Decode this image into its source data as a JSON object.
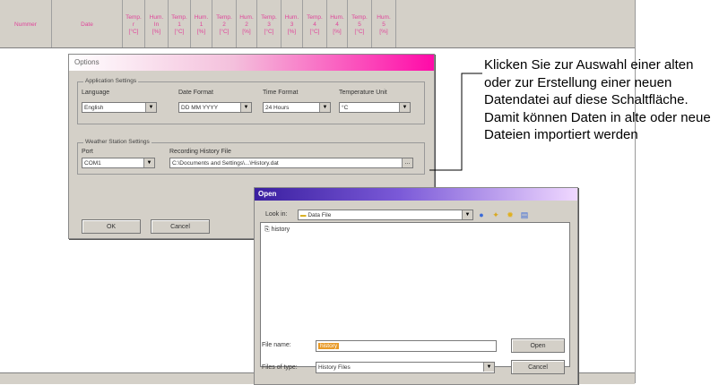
{
  "columns": [
    {
      "lines": [
        "Nummer"
      ]
    },
    {
      "lines": [
        "Date"
      ]
    },
    {
      "lines": [
        "Temp.",
        "r",
        "[°C]"
      ]
    },
    {
      "lines": [
        "Hum.",
        "In",
        "[%]"
      ]
    },
    {
      "lines": [
        "Temp.",
        "1",
        "[°C]"
      ]
    },
    {
      "lines": [
        "Hum.",
        "1",
        "[%]"
      ]
    },
    {
      "lines": [
        "Temp.",
        "2",
        "[°C]"
      ]
    },
    {
      "lines": [
        "Hum.",
        "2",
        "[%]"
      ]
    },
    {
      "lines": [
        "Temp.",
        "3",
        "[°C]"
      ]
    },
    {
      "lines": [
        "Hum.",
        "3",
        "[%]"
      ]
    },
    {
      "lines": [
        "Temp.",
        "4",
        "[°C]"
      ]
    },
    {
      "lines": [
        "Hum.",
        "4",
        "[%]"
      ]
    },
    {
      "lines": [
        "Temp.",
        "5",
        "[°C]"
      ]
    },
    {
      "lines": [
        "Hum.",
        "5",
        "[%]"
      ]
    }
  ],
  "options": {
    "title": "Options",
    "app_group": "Application Settings",
    "language_label": "Language",
    "language_value": "English",
    "date_label": "Date Format",
    "date_value": "DD MM YYYY",
    "time_label": "Time Format",
    "time_value": "24 Hours",
    "temp_label": "Temperature Unit",
    "temp_value": "°C",
    "ws_group": "Weather Station Settings",
    "port_label": "Port",
    "port_value": "COM1",
    "history_label": "Recording History File",
    "history_value": "C:\\Documents and Settings\\...\\History.dat",
    "ok_label": "OK",
    "cancel_label": "Cancel"
  },
  "open_dialog": {
    "title": "Open",
    "lookin_label": "Look in:",
    "lookin_value": "Data File",
    "file_item": "history",
    "filename_label": "File name:",
    "filename_value": "history",
    "filetype_label": "Files of type:",
    "filetype_value": "History Files",
    "open_label": "Open",
    "cancel_label": "Cancel"
  },
  "annotation": "Klicken Sie zur Auswahl einer alten oder zur Erstellung einer neuen Datendatei auf diese Schaltfläche. Damit können Daten in alte oder neue Dateien importiert werden",
  "colors": {
    "header_text": "#e0449a",
    "options_title_end": "#ff0aa8",
    "open_title_start": "#3a1fa0"
  }
}
